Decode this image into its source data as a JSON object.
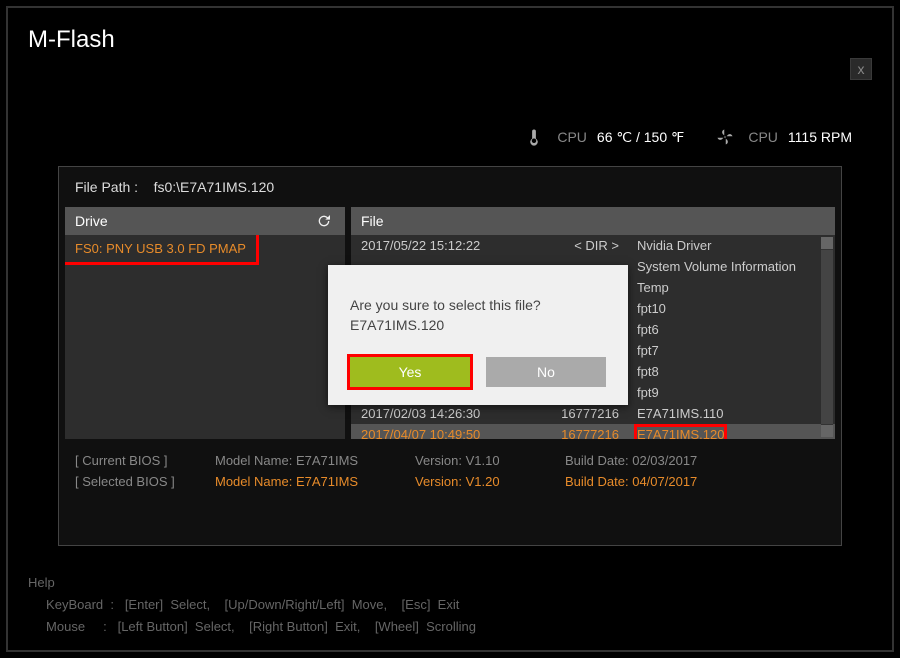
{
  "title": "M-Flash",
  "close_label": "x",
  "status": {
    "cpu_temp_label": "CPU",
    "cpu_temp_value": "66 ℃ / 150 ℉",
    "cpu_fan_label": "CPU",
    "cpu_fan_value": "1115 RPM"
  },
  "filepath_label": "File Path :",
  "filepath_value": "fs0:\\E7A71IMS.120",
  "drive_header": "Drive",
  "file_header": "File",
  "drive": {
    "item": "FS0: PNY USB 3.0 FD PMAP"
  },
  "files": [
    {
      "date": "2017/05/22 15:12:22",
      "size": "< DIR >",
      "name": "Nvidia Driver"
    },
    {
      "date": "",
      "size": "",
      "name": "System Volume Information"
    },
    {
      "date": "",
      "size": "",
      "name": "Temp"
    },
    {
      "date": "",
      "size": "",
      "name": "fpt10"
    },
    {
      "date": "",
      "size": "",
      "name": "fpt6"
    },
    {
      "date": "",
      "size": "",
      "name": "fpt7"
    },
    {
      "date": "",
      "size": "",
      "name": "fpt8"
    },
    {
      "date": "",
      "size": "",
      "name": "fpt9"
    },
    {
      "date": "2017/02/03 14:26:30",
      "size": "16777216",
      "name": "E7A71IMS.110"
    },
    {
      "date": "2017/04/07 10:49:50",
      "size": "16777216",
      "name": "E7A71IMS.120",
      "selected": true
    }
  ],
  "info": {
    "current_label": "[ Current BIOS   ]",
    "selected_label": "[ Selected BIOS ]",
    "model_label": "Model Name:",
    "model_value": "E7A71IMS",
    "version_label": "Version:",
    "current_version": "V1.10",
    "selected_version": "V1.20",
    "build_label": "Build Date:",
    "current_build": "02/03/2017",
    "selected_build": "04/07/2017"
  },
  "dialog": {
    "message": "Are you sure to select this file?",
    "filename": "E7A71IMS.120",
    "yes": "Yes",
    "no": "No"
  },
  "help": {
    "title": "Help",
    "keyboard": "     KeyBoard  :   [Enter]  Select,    [Up/Down/Right/Left]  Move,    [Esc]  Exit",
    "mouse": "     Mouse     :   [Left Button]  Select,    [Right Button]  Exit,    [Wheel]  Scrolling"
  }
}
